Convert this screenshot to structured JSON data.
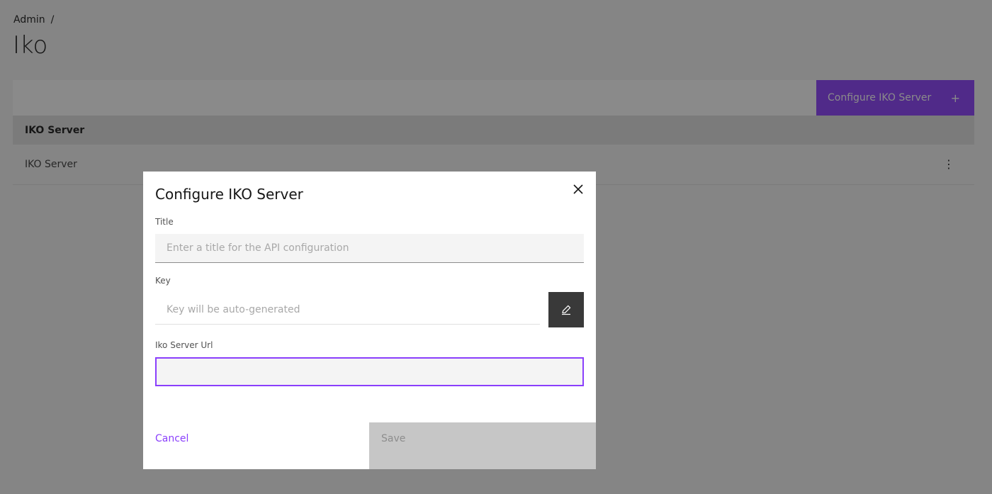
{
  "breadcrumb": {
    "root": "Admin",
    "separator": "/"
  },
  "page": {
    "title": "Iko"
  },
  "toolbar": {
    "configure_button_label": "Configure IKO Server",
    "configure_button_icon": "+"
  },
  "table": {
    "header": "IKO Server",
    "rows": [
      {
        "name": "IKO Server",
        "overflow_icon": "⋮"
      }
    ]
  },
  "modal": {
    "title": "Configure IKO Server",
    "fields": {
      "title": {
        "label": "Title",
        "placeholder": "Enter a title for the API configuration",
        "value": ""
      },
      "key": {
        "label": "Key",
        "placeholder": "Key will be auto-generated",
        "value": ""
      },
      "url": {
        "label": "Iko Server Url",
        "value": ""
      }
    },
    "cancel_label": "Cancel",
    "save_label": "Save"
  },
  "colors": {
    "accent": "#8a3ffc",
    "overlay": "rgba(22,22,22,0.5)",
    "edit_button": "#393939",
    "disabled": "#c6c6c6"
  },
  "icons": {
    "add": "plus-icon",
    "overflow": "overflow-menu-icon",
    "close": "close-icon",
    "edit": "edit-icon"
  }
}
